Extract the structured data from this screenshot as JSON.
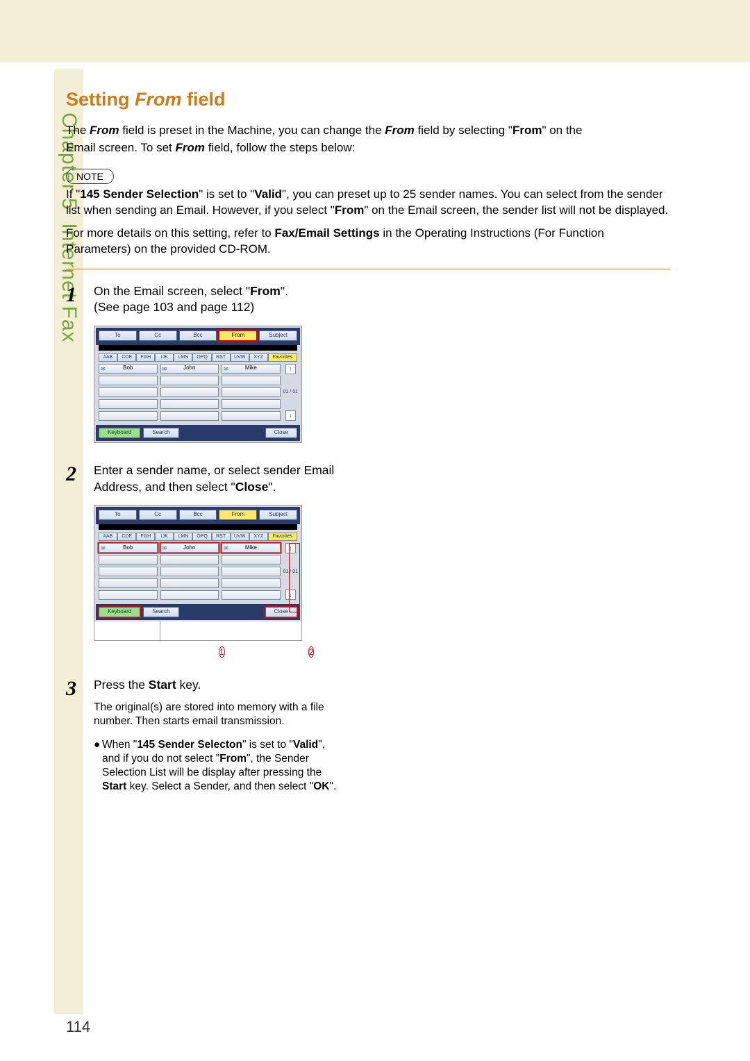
{
  "sidebar": {
    "chapter": "Chapter 5",
    "section": "Internet Fax"
  },
  "title": {
    "prefix": "Setting",
    "italic": "From",
    "suffix": "field"
  },
  "intro": {
    "l1a": "The ",
    "l1b": "From",
    "l1c": " field is preset in the Machine, you can change the ",
    "l1d": "From",
    "l1e": " field by selecting \"",
    "l1f": "From",
    "l1g": "\" on the",
    "l2a": "Email screen. To set ",
    "l2b": "From",
    "l2c": " field, follow the steps below:"
  },
  "note": {
    "label": "NOTE",
    "p1a": "If \"",
    "p1b": "145 Sender Selection",
    "p1c": "\" is set to \"",
    "p1d": "Valid",
    "p1e": "\", you can preset up to 25 sender names. You can select from the sender list when sending an Email. However, if you select \"",
    "p1f": "From",
    "p1g": "\" on the Email screen, the sender list will not be displayed.",
    "p2a": "For more details on this setting, refer to ",
    "p2b": "Fax/Email Settings",
    "p2c": " in the Operating Instructions (For Function Parameters) on the provided CD-ROM."
  },
  "steps": {
    "s1": {
      "num": "1",
      "l1a": "On the Email screen, select \"",
      "l1b": "From",
      "l1c": "\".",
      "l2": "(See page 103 and page 112)"
    },
    "s2": {
      "num": "2",
      "l1": "Enter a sender name, or select sender Email Address, and then select \"",
      "l1b": "Close",
      "l1c": "\"."
    },
    "s3": {
      "num": "3",
      "l1a": "Press the ",
      "l1b": "Start",
      "l1c": " key.",
      "sub": "The original(s) are stored into memory with a file number. Then starts email transmission.",
      "bul_a": "When \"",
      "bul_b": "145 Sender Selecton",
      "bul_c": "\" is set to \"",
      "bul_d": "Valid",
      "bul_e": "\", and if you do not select \"",
      "bul_f": "From",
      "bul_g": "\", the Sender Selection List will be display after pressing the ",
      "bul_h": "Start",
      "bul_i": " key. Select a Sender, and then select \"",
      "bul_j": "OK",
      "bul_k": "\"."
    }
  },
  "ss": {
    "tabs": [
      "To",
      "Cc",
      "Bcc",
      "From",
      "Subject"
    ],
    "alpha": [
      "#AB",
      "CDE",
      "FGH",
      "IJK",
      "LMN",
      "OPQ",
      "RST",
      "UVW",
      "XYZ",
      "Favorites"
    ],
    "names": [
      "Bob",
      "John",
      "Mike"
    ],
    "page": "01 / 01",
    "btn_kb": "Keyboard",
    "btn_search": "Search",
    "btn_close": "Close"
  },
  "callouts": {
    "c1": "1",
    "c2": "2"
  },
  "page_number": "114"
}
